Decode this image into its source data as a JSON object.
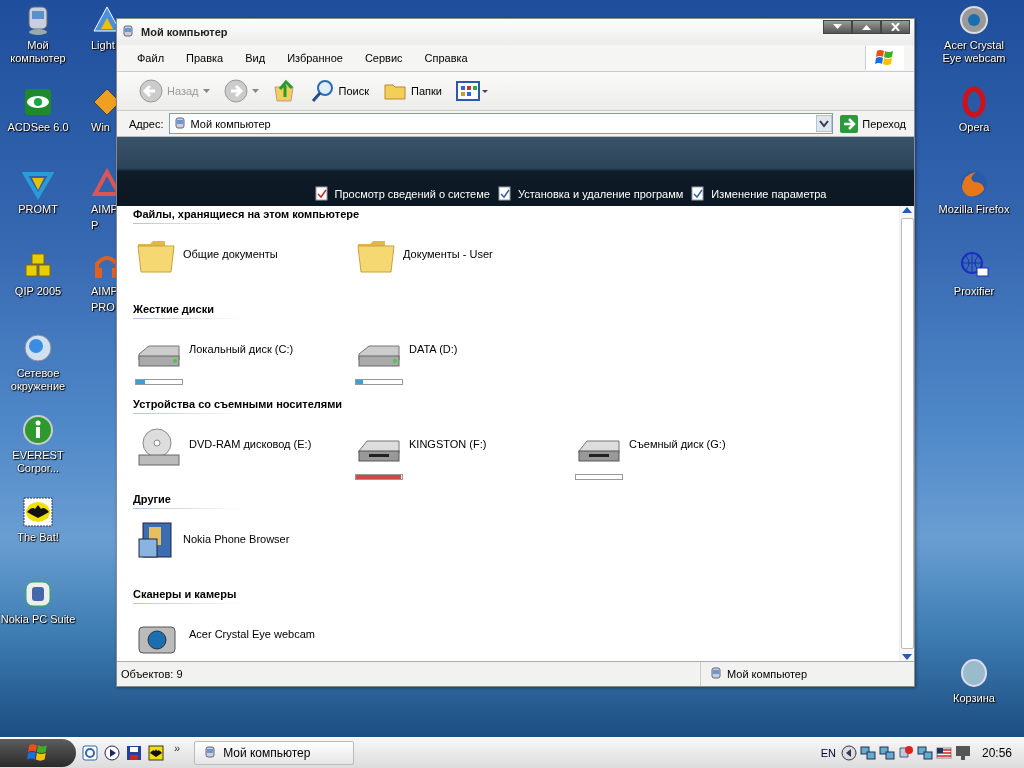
{
  "desktop_icons_left": [
    {
      "label": "Мой компьютер",
      "kind": "computer"
    },
    {
      "label": "ACDSee 6.0",
      "kind": "eye"
    },
    {
      "label": "PROMT",
      "kind": "promt"
    },
    {
      "label": "QIP 2005",
      "kind": "qip"
    },
    {
      "label": "Сетевое окружение",
      "kind": "globe"
    },
    {
      "label": "EVEREST Corpor...",
      "kind": "info"
    },
    {
      "label": "The Bat!",
      "kind": "bat"
    },
    {
      "label": "Nokia PC Suite",
      "kind": "nokia"
    }
  ],
  "desktop_icons_partial": [
    {
      "lines": [
        "Light"
      ],
      "kind": "light"
    },
    {
      "lines": [
        "Win"
      ],
      "kind": "win"
    },
    {
      "lines": [
        "AIMP",
        "P"
      ],
      "kind": "aimp"
    },
    {
      "lines": [
        "AIMP",
        "PRO"
      ],
      "kind": "aimp2"
    }
  ],
  "desktop_icons_right": [
    {
      "label": "Acer Crystal Eye webcam",
      "kind": "webcam"
    },
    {
      "label": "Opera",
      "kind": "opera"
    },
    {
      "label": "Mozilla Firefox",
      "kind": "firefox"
    },
    {
      "label": "Proxifier",
      "kind": "proxifier"
    }
  ],
  "recycle_bin": {
    "label": "Корзина"
  },
  "window": {
    "title": "Мой компьютер",
    "menu": [
      "Файл",
      "Правка",
      "Вид",
      "Избранное",
      "Сервис",
      "Справка"
    ],
    "toolbar": [
      {
        "kind": "back",
        "label": "Назад",
        "disabled": true
      },
      {
        "kind": "forward",
        "disabled": true
      },
      {
        "kind": "up"
      },
      {
        "kind": "search",
        "label": "Поиск"
      },
      {
        "kind": "folders",
        "label": "Папки"
      },
      {
        "kind": "views"
      }
    ],
    "address": {
      "label": "Адрес:",
      "value": "Мой компьютер",
      "go": "Переход"
    },
    "tasks": [
      "Просмотр сведений о системе",
      "Установка и удаление программ",
      "Изменение параметра"
    ],
    "sections": [
      {
        "title": "Файлы, хранящиеся на этом компьютере",
        "items": [
          {
            "kind": "folder",
            "label": "Общие документы"
          },
          {
            "kind": "folder",
            "label": "Документы - User"
          }
        ]
      },
      {
        "title": "Жесткие диски",
        "items": [
          {
            "kind": "drive",
            "label": "Локальный диск (C:)",
            "level": 0.2
          },
          {
            "kind": "drive",
            "label": "DATA (D:)",
            "level": 0.15
          }
        ]
      },
      {
        "title": "Устройства со съемными носителями",
        "items": [
          {
            "kind": "dvd",
            "label": "DVD-RAM дисковод (E:)"
          },
          {
            "kind": "removable",
            "label": "KINGSTON (F:)",
            "level": 0.97
          },
          {
            "kind": "removable",
            "label": "Съемный диск (G:)",
            "level": 0.0
          }
        ]
      },
      {
        "title": "Другие",
        "items": [
          {
            "kind": "phone",
            "label": "Nokia Phone Browser"
          }
        ]
      },
      {
        "title": "Сканеры и камеры",
        "items": [
          {
            "kind": "camera",
            "label": "Acer Crystal Eye webcam"
          }
        ]
      }
    ],
    "status": {
      "count": "Объектов: 9",
      "location": "Мой компьютер"
    }
  },
  "taskbar": {
    "chevron": "»",
    "tasks": [
      {
        "label": "Мой компьютер",
        "selected": false
      }
    ],
    "language": "EN",
    "clock": "20:56"
  }
}
